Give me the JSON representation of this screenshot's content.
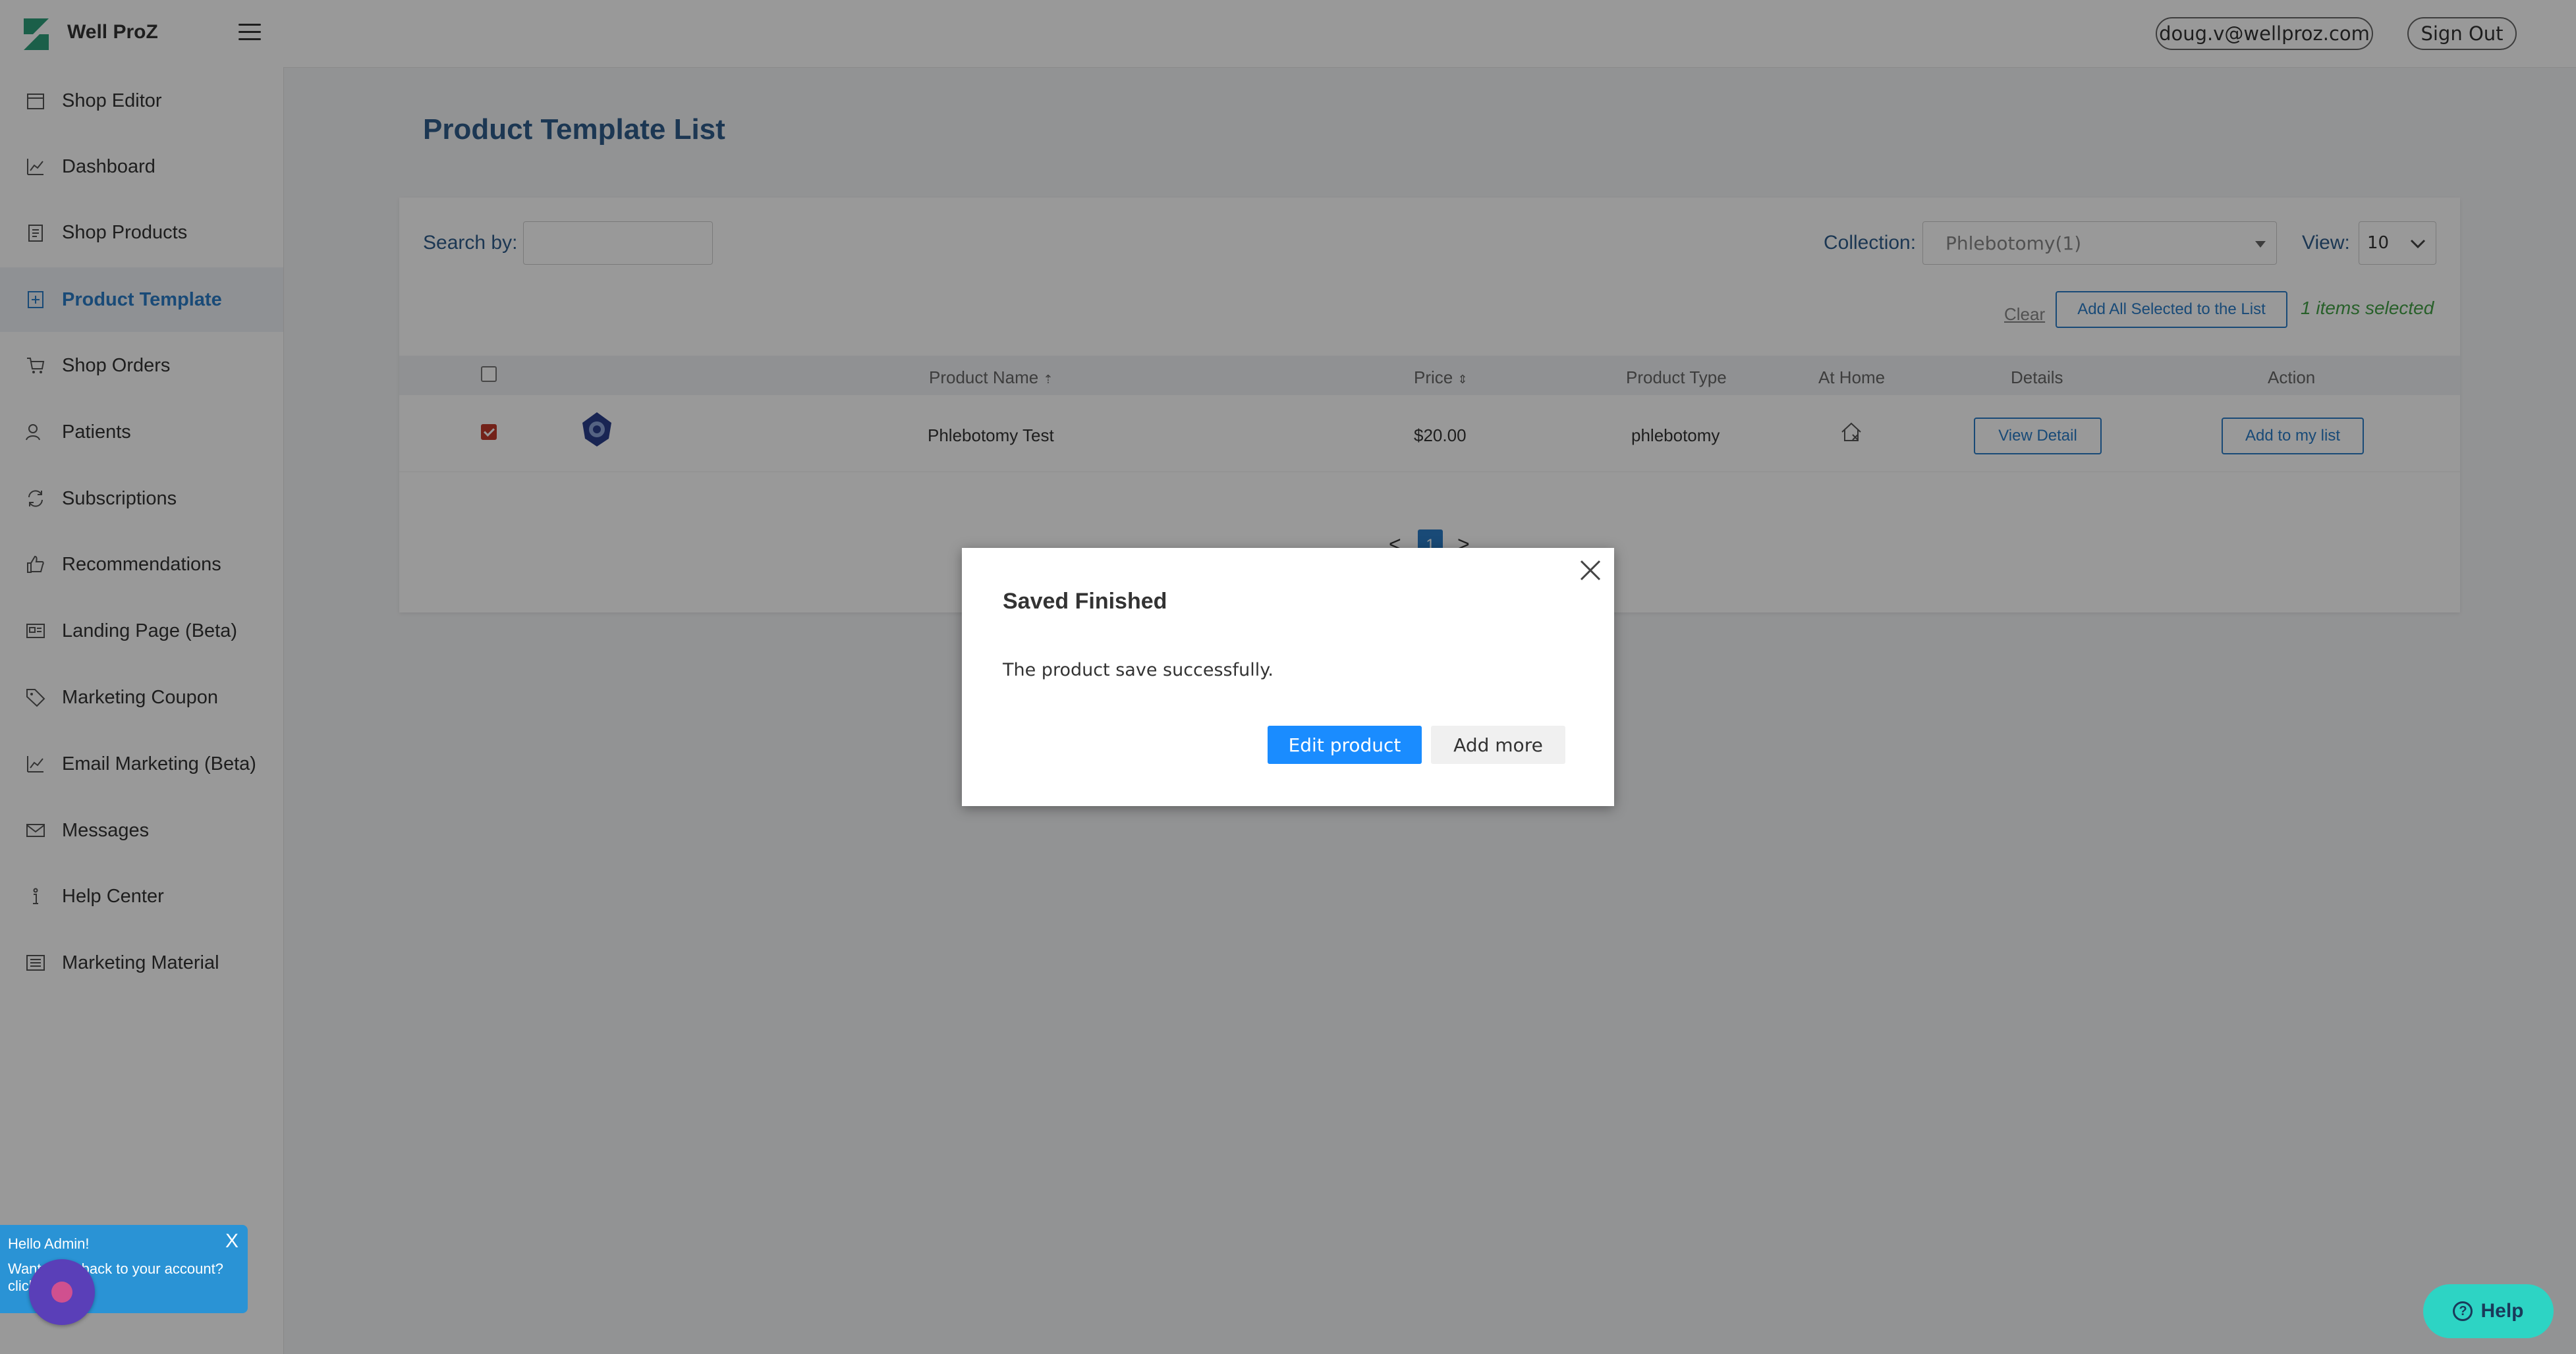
{
  "header": {
    "brand": "Well ProZ",
    "user_email": "doug.v@wellproz.com",
    "sign_out": "Sign Out"
  },
  "sidebar": {
    "items": [
      {
        "label": "Shop Editor",
        "icon": "shop-editor-icon"
      },
      {
        "label": "Dashboard",
        "icon": "chart-icon"
      },
      {
        "label": "Shop Products",
        "icon": "clipboard-icon"
      },
      {
        "label": "Product Template",
        "icon": "template-plus-icon",
        "active": true
      },
      {
        "label": "Shop Orders",
        "icon": "cart-icon"
      },
      {
        "label": "Patients",
        "icon": "patients-icon"
      },
      {
        "label": "Subscriptions",
        "icon": "refresh-icon"
      },
      {
        "label": "Recommendations",
        "icon": "thumbs-up-icon"
      },
      {
        "label": "Landing Page (Beta)",
        "icon": "landing-page-icon"
      },
      {
        "label": "Marketing Coupon",
        "icon": "tag-icon"
      },
      {
        "label": "Email Marketing (Beta)",
        "icon": "chart-icon"
      },
      {
        "label": "Messages",
        "icon": "envelope-icon"
      },
      {
        "label": "Help Center",
        "icon": "info-icon"
      },
      {
        "label": "Marketing Material",
        "icon": "list-icon"
      }
    ]
  },
  "chat_widget": {
    "greeting": "Hello Admin!",
    "message": "Want to go back to your account? click here",
    "close": "X"
  },
  "main": {
    "title": "Product Template List",
    "search_label": "Search by:",
    "search_value": "",
    "collection_label": "Collection:",
    "collection_value": "Phlebotomy(1)",
    "view_label": "View:",
    "view_value": "10",
    "clear_label": "Clear",
    "add_all_label": "Add All Selected to the List",
    "selected_count": "1 items selected",
    "columns": [
      "Product Name",
      "Price",
      "Product Type",
      "At Home",
      "Details",
      "Action"
    ],
    "rows": [
      {
        "checked": true,
        "name": "Phlebotomy Test",
        "price": "$20.00",
        "type": "phlebotomy",
        "details_btn": "View Detail",
        "action_btn": "Add to my list"
      }
    ],
    "pagination": {
      "prev": "<",
      "current": "1",
      "next": ">"
    }
  },
  "modal": {
    "title": "Saved Finished",
    "message": "The product save successfully.",
    "primary_btn": "Edit product",
    "secondary_btn": "Add more"
  },
  "help": {
    "label": "Help"
  },
  "colors": {
    "accent": "#2a7cc7",
    "primary_button": "#1a8cff",
    "selected_text": "#43a047",
    "help_button": "#2dd4c4"
  }
}
